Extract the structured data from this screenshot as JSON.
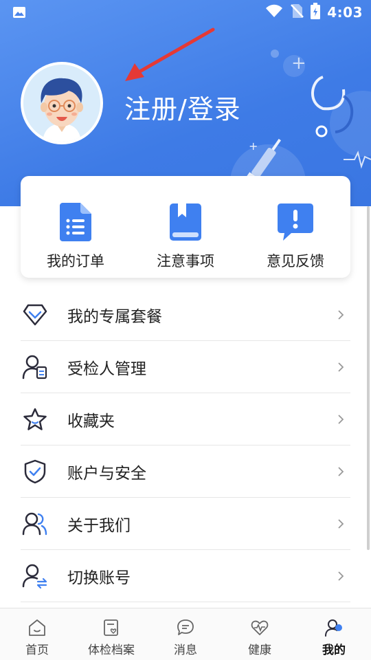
{
  "status_bar": {
    "time": "4:03"
  },
  "header": {
    "login_label": "注册/登录"
  },
  "quick_actions": [
    {
      "label": "我的订单",
      "icon": "document-list-icon"
    },
    {
      "label": "注意事项",
      "icon": "book-icon"
    },
    {
      "label": "意见反馈",
      "icon": "feedback-icon"
    }
  ],
  "menu": [
    {
      "label": "我的专属套餐",
      "icon": "diamond-icon"
    },
    {
      "label": "受检人管理",
      "icon": "person-card-icon"
    },
    {
      "label": "收藏夹",
      "icon": "star-icon"
    },
    {
      "label": "账户与安全",
      "icon": "shield-check-icon"
    },
    {
      "label": "关于我们",
      "icon": "people-icon"
    },
    {
      "label": "切换账号",
      "icon": "switch-account-icon"
    }
  ],
  "bottom_nav": [
    {
      "label": "首页",
      "icon": "home-icon"
    },
    {
      "label": "体检档案",
      "icon": "record-icon"
    },
    {
      "label": "消息",
      "icon": "message-icon"
    },
    {
      "label": "健康",
      "icon": "heart-icon"
    },
    {
      "label": "我的",
      "icon": "profile-icon",
      "active": true
    }
  ],
  "colors": {
    "primary": "#3e7be6",
    "accent_red": "#e53935"
  }
}
